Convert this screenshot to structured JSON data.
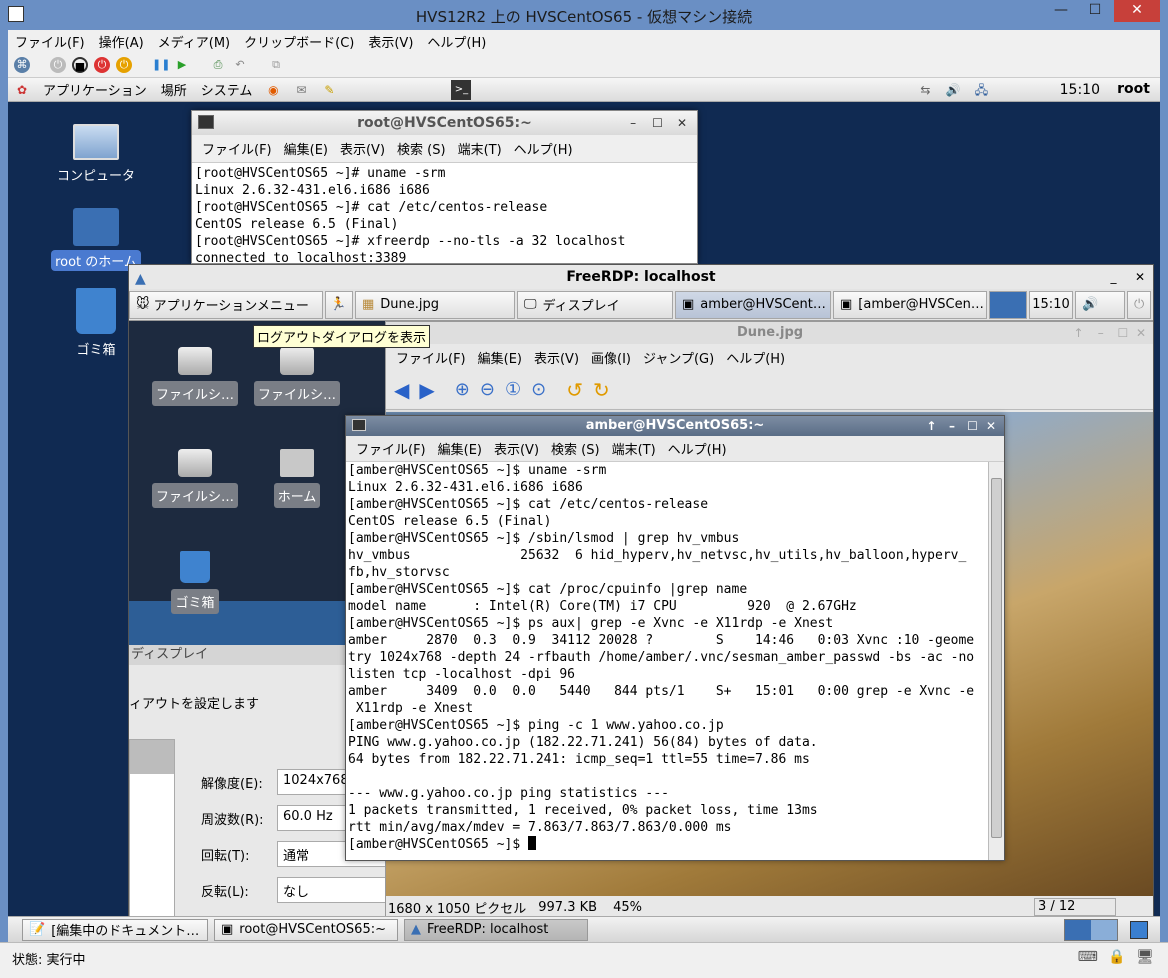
{
  "hyperv": {
    "title": "HVS12R2 上の HVSCentOS65 - 仮想マシン接続",
    "menus": [
      "ファイル(F)",
      "操作(A)",
      "メディア(M)",
      "クリップボード(C)",
      "表示(V)",
      "ヘルプ(H)"
    ],
    "status": "状態: 実行中"
  },
  "gnome": {
    "menus": [
      "アプリケーション",
      "場所",
      "システム"
    ],
    "clock": "15:10",
    "user": "root",
    "desktop_icons": [
      "コンピュータ",
      "root のホーム",
      "ゴミ箱"
    ],
    "taskbar": [
      "[編集中のドキュメント…",
      "root@HVSCentOS65:~",
      "FreeRDP: localhost"
    ]
  },
  "rootterm": {
    "title": "root@HVSCentOS65:~",
    "menus": [
      "ファイル(F)",
      "編集(E)",
      "表示(V)",
      "検索 (S)",
      "端末(T)",
      "ヘルプ(H)"
    ],
    "lines": "[root@HVSCentOS65 ~]# uname -srm\nLinux 2.6.32-431.el6.i686 i686\n[root@HVSCentOS65 ~]# cat /etc/centos-release\nCentOS release 6.5 (Final)\n[root@HVSCentOS65 ~]# xfreerdp --no-tls -a 32 localhost\nconnected to localhost:3389"
  },
  "freerdp": {
    "title": "FreeRDP: localhost",
    "panel": {
      "apps_menu": "アプリケーションメニュー",
      "tasks": [
        "Dune.jpg",
        "ディスプレイ",
        "amber@HVSCent…",
        "[amber@HVSCen…"
      ],
      "clock": "15:10"
    },
    "tooltip": "ログアウトダイアログを表示",
    "desktop_icons": [
      "ファイルシ…",
      "ファイルシ…",
      "ファイルシ…",
      "ホーム",
      "ゴミ箱"
    ]
  },
  "display_settings": {
    "header": "ディスプレイ",
    "subtitle": "ィアウトを設定します",
    "rows": [
      {
        "label": "解像度(E):",
        "value": "1024x768"
      },
      {
        "label": "周波数(R):",
        "value": "60.0 Hz"
      },
      {
        "label": "回転(T):",
        "value": "通常"
      },
      {
        "label": "反転(L):",
        "value": "なし"
      }
    ]
  },
  "viewer": {
    "title": "Dune.jpg",
    "menus": [
      "ファイル(F)",
      "編集(E)",
      "表示(V)",
      "画像(I)",
      "ジャンプ(G)",
      "ヘルプ(H)"
    ],
    "status_size": "1680 x 1050 ピクセル",
    "status_bytes": "997.3 KB",
    "status_zoom": "45%",
    "status_index": "3 / 12"
  },
  "amberterm": {
    "title": "amber@HVSCentOS65:~",
    "menus": [
      "ファイル(F)",
      "編集(E)",
      "表示(V)",
      "検索 (S)",
      "端末(T)",
      "ヘルプ(H)"
    ],
    "lines": "[amber@HVSCentOS65 ~]$ uname -srm\nLinux 2.6.32-431.el6.i686 i686\n[amber@HVSCentOS65 ~]$ cat /etc/centos-release\nCentOS release 6.5 (Final)\n[amber@HVSCentOS65 ~]$ /sbin/lsmod | grep hv_vmbus\nhv_vmbus              25632  6 hid_hyperv,hv_netvsc,hv_utils,hv_balloon,hyperv_\nfb,hv_storvsc\n[amber@HVSCentOS65 ~]$ cat /proc/cpuinfo |grep name\nmodel name      : Intel(R) Core(TM) i7 CPU         920  @ 2.67GHz\n[amber@HVSCentOS65 ~]$ ps aux| grep -e Xvnc -e X11rdp -e Xnest\namber     2870  0.3  0.9  34112 20028 ?        S    14:46   0:03 Xvnc :10 -geome\ntry 1024x768 -depth 24 -rfbauth /home/amber/.vnc/sesman_amber_passwd -bs -ac -no\nlisten tcp -localhost -dpi 96\namber     3409  0.0  0.0   5440   844 pts/1    S+   15:01   0:00 grep -e Xvnc -e\n X11rdp -e Xnest\n[amber@HVSCentOS65 ~]$ ping -c 1 www.yahoo.co.jp\nPING www.g.yahoo.co.jp (182.22.71.241) 56(84) bytes of data.\n64 bytes from 182.22.71.241: icmp_seq=1 ttl=55 time=7.86 ms\n\n--- www.g.yahoo.co.jp ping statistics ---\n1 packets transmitted, 1 received, 0% packet loss, time 13ms\nrtt min/avg/max/mdev = 7.863/7.863/7.863/0.000 ms",
    "prompt": "[amber@HVSCentOS65 ~]$ "
  }
}
